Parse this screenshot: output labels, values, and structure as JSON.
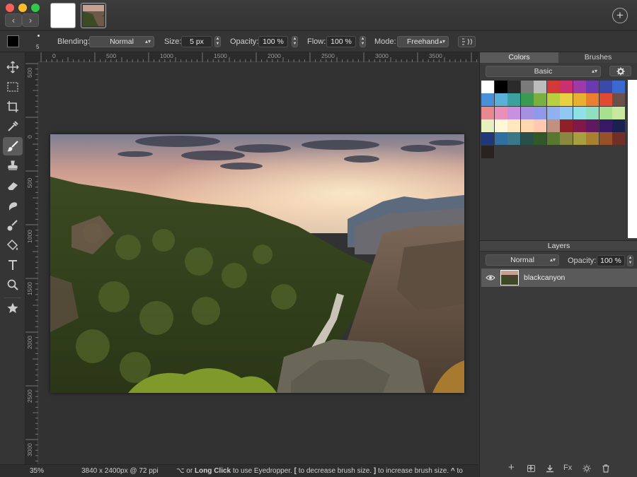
{
  "window": {
    "back_glyph": "‹",
    "forward_glyph": "›",
    "add_glyph": "+"
  },
  "options": {
    "blending_label": "Blending:",
    "blending_value": "Normal",
    "size_label": "Size:",
    "size_value": "5 px",
    "opacity_label": "Opacity:",
    "opacity_value": "100 %",
    "flow_label": "Flow:",
    "flow_value": "100 %",
    "mode_label": "Mode:",
    "mode_value": "Freehand",
    "brush_size_small": "5"
  },
  "colors": {
    "foreground": "#000000"
  },
  "ruler": {
    "h_labels": [
      "0",
      "500",
      "1000",
      "1500",
      "2000",
      "2500",
      "3000",
      "3500"
    ],
    "v_labels": [
      "500",
      "0",
      "500",
      "1000",
      "1500",
      "2000",
      "2500",
      "3000"
    ]
  },
  "status": {
    "zoom": "35%",
    "doc_info": "3840 x 2400px @ 72 ppi",
    "hint_prefix": "⌥ or ",
    "hint_bold1": "Long Click",
    "hint_mid1": " to use Eyedropper.  ",
    "hint_bold2": "[",
    "hint_mid2": " to decrease brush size.  ",
    "hint_bold3": "]",
    "hint_mid3": " to increase brush size.  ",
    "hint_bold4": "^",
    "hint_end": " to"
  },
  "panel": {
    "tab_colors": "Colors",
    "tab_brushes": "Brushes",
    "palette_value": "Basic",
    "swatches": [
      [
        "#ffffff",
        "#000000",
        "#2b2b2b",
        "#7a7a7a",
        "#bdbdbd",
        "#d23a3a",
        "#c83070",
        "#9c3aa8",
        "#6a3ab0",
        "#3a4aa8",
        "#3a6ad0"
      ],
      [
        "#4a90d8",
        "#5ab0d8",
        "#3aa0a0",
        "#3a9a50",
        "#7ab040",
        "#b8d040",
        "#e8d040",
        "#e8b030",
        "#e88030",
        "#e04a30",
        "#6a5048"
      ],
      [
        "#e88890",
        "#e890b8",
        "#c890e0",
        "#a890e0",
        "#9098e8",
        "#90b0f0",
        "#90c8f0",
        "#90e0e8",
        "#90e0c0",
        "#a8e090",
        "#c8e8a0"
      ],
      [
        "#e8f0c0",
        "#fff8d8",
        "#ffe8c0",
        "#ffd8b0",
        "#ffc8b0",
        "#c09080",
        "#902028",
        "#801848",
        "#601860",
        "#3a1868",
        "#1a2050"
      ],
      [
        "#203878",
        "#3070a0",
        "#3a7888",
        "#285048",
        "#305828",
        "#587830",
        "#8a8840",
        "#a8a040",
        "#a88030",
        "#985028",
        "#703028"
      ],
      [
        "#2a2220"
      ]
    ],
    "layers_title": "Layers",
    "layer_blend": "Normal",
    "layer_opacity_label": "Opacity:",
    "layer_opacity_value": "100 %",
    "layer_name": "blackcanyon",
    "footer_add": "+",
    "footer_fx": "Fx"
  }
}
